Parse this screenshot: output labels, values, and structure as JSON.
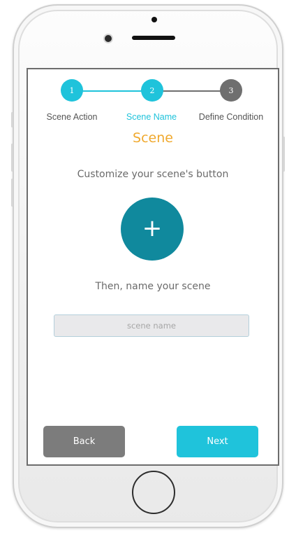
{
  "colors": {
    "accent_cyan": "#1fc3db",
    "step_inactive": "#6f6f6f",
    "title_orange": "#f0a92e",
    "plus_button_teal": "#10899d",
    "back_button_gray": "#7c7c7c",
    "label_gray": "#6a6a6a"
  },
  "stepper": {
    "steps": [
      {
        "number": "1",
        "label": "Scene Action",
        "state": "completed"
      },
      {
        "number": "2",
        "label": "Scene Name",
        "state": "active"
      },
      {
        "number": "3",
        "label": "Define Condition",
        "state": "inactive"
      }
    ]
  },
  "main": {
    "title": "Scene",
    "customize_prompt": "Customize your scene's button",
    "plus_icon": "plus-icon",
    "plus_glyph": "+",
    "name_prompt": "Then, name your scene",
    "name_input": {
      "value": "",
      "placeholder": "scene name"
    }
  },
  "footer": {
    "back_label": "Back",
    "next_label": "Next"
  }
}
